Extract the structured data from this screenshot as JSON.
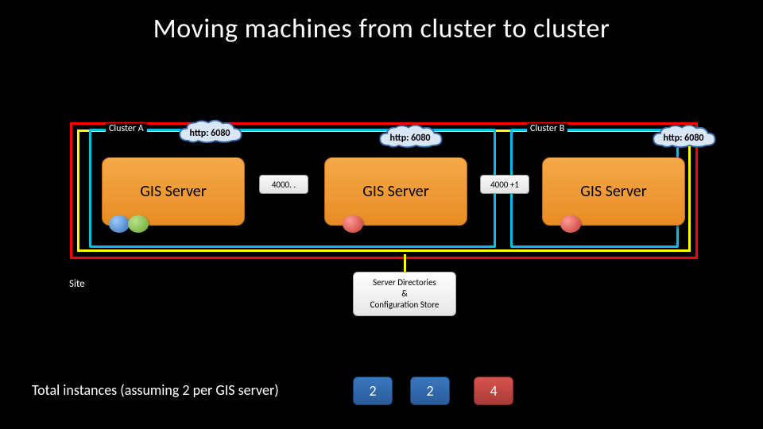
{
  "title": "Moving machines from cluster to cluster",
  "clusters": {
    "a": {
      "label": "Cluster A"
    },
    "b": {
      "label": "Cluster B"
    }
  },
  "site_label": "Site",
  "clouds": [
    "http: 6080",
    "http: 6080",
    "http: 6080"
  ],
  "servers": {
    "label": "GIS Server"
  },
  "ports": [
    "4000. .",
    "4000 +1"
  ],
  "server_directories": "Server Directories\n&\nConfiguration Store",
  "footer": {
    "label": "Total instances (assuming 2 per GIS server)",
    "counts": [
      "2",
      "2",
      "4"
    ]
  }
}
